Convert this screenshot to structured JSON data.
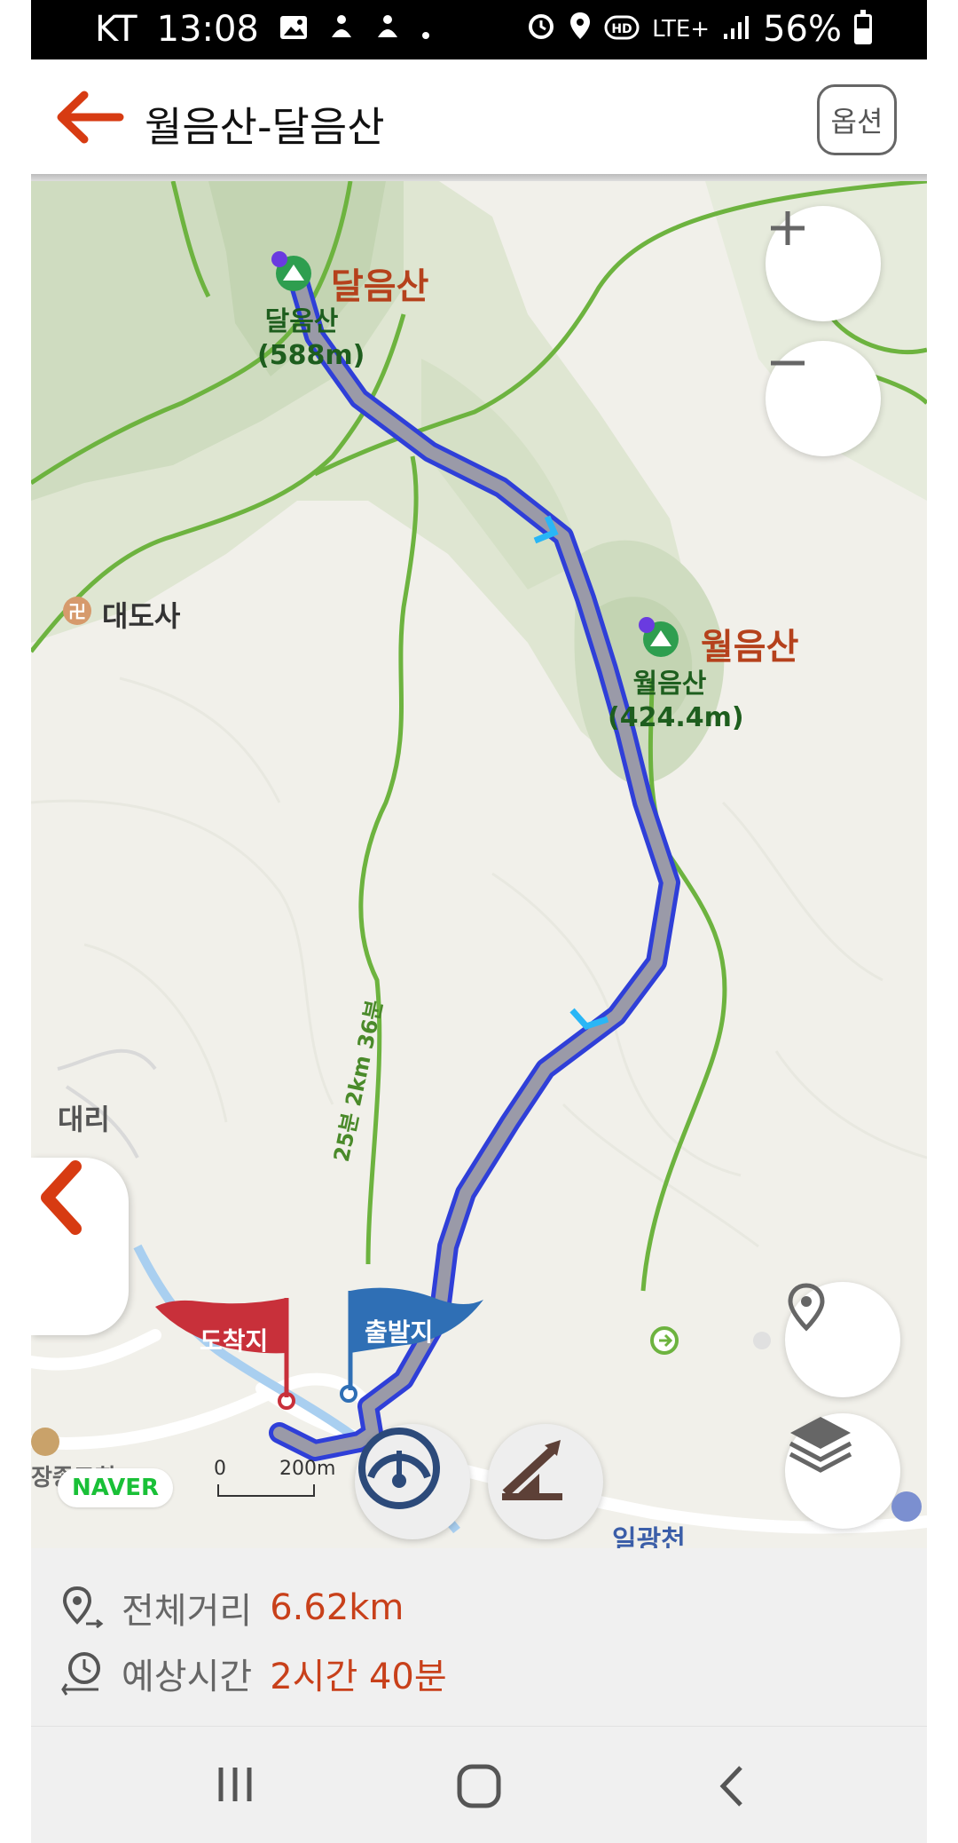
{
  "status_bar": {
    "carrier": "KT",
    "time": "13:08",
    "network": "LTE+",
    "battery": "56%",
    "icons": [
      "image-icon",
      "notification-icon",
      "notification-icon",
      "dot-icon",
      "alarm-icon",
      "location-icon",
      "hd-icon",
      "lte-icon",
      "signal-icon",
      "battery-icon"
    ]
  },
  "app_bar": {
    "title": "월음산-달음산",
    "option_label": "옵션",
    "back_icon": "arrow-left-icon"
  },
  "map": {
    "peaks": [
      {
        "name": "달음산",
        "label": "달음산",
        "elevation": "(588m)"
      },
      {
        "name": "월음산",
        "label": "월음산",
        "elevation": "(424.4m)"
      }
    ],
    "places": [
      "대도사",
      "대리",
      "일광천",
      "장종교회"
    ],
    "route_label": "25분 2km 36분",
    "start_flag": "출발지",
    "end_flag": "도착지",
    "provider": "NAVER",
    "scale": {
      "zero": "0",
      "distance": "200m"
    },
    "controls": [
      "zoom-in-icon",
      "zoom-out-icon",
      "my-location-icon",
      "layers-icon",
      "speed-gauge-icon",
      "elevation-profile-icon",
      "collapse-panel-icon"
    ],
    "colors": {
      "route": "#2f3fd8",
      "route_fill": "#9a9aa8",
      "peak_text": "#b5411c",
      "start_flag": "#2f6fb5",
      "end_flag": "#c8303a",
      "trail": "#6db33f"
    }
  },
  "summary": {
    "distance_label": "전체거리",
    "distance_value": "6.62km",
    "time_label": "예상시간",
    "time_value": "2시간 40분"
  },
  "nav_bar": {
    "buttons": [
      "recent-apps-icon",
      "home-icon",
      "back-icon"
    ]
  }
}
